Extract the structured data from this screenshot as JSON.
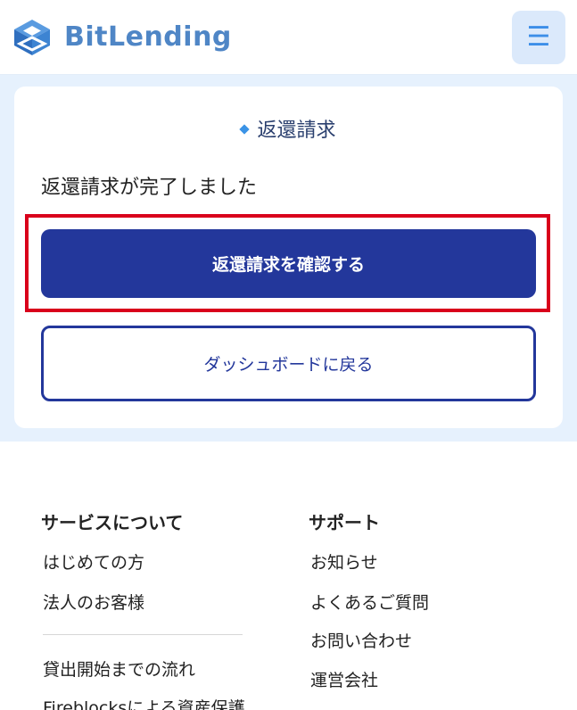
{
  "header": {
    "logo_text": "BitLending",
    "menu_icon": "hamburger-icon"
  },
  "main": {
    "section_title": "返還請求",
    "done_message": "返還請求が完了しました",
    "confirm_button": "返還請求を確認する",
    "dashboard_button": "ダッシュボードに戻る"
  },
  "colors": {
    "primary": "#23379b",
    "accent": "#3a93e6",
    "band_bg": "#e6f1fd",
    "highlight": "#d9001b"
  },
  "footer": {
    "services": {
      "heading": "サービスについて",
      "links": [
        "はじめての方",
        "法人のお客様",
        "貸出開始までの流れ",
        "Fireblocksによる資産保護"
      ]
    },
    "support": {
      "heading": "サポート",
      "links": [
        "お知らせ",
        "よくあるご質問",
        "お問い合わせ",
        "運営会社"
      ]
    }
  }
}
